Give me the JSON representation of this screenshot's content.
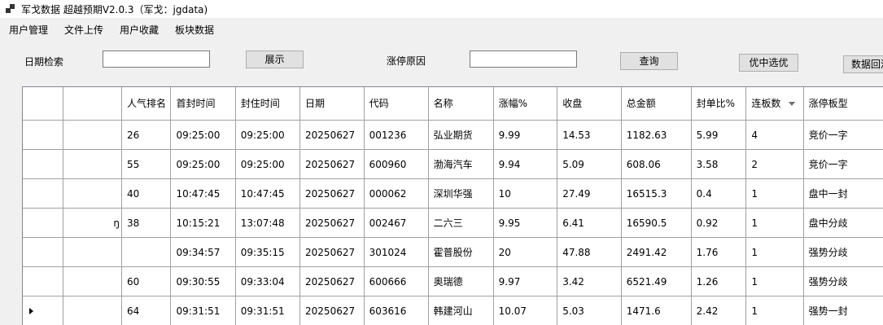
{
  "window": {
    "title": "军戈数据 超越预期V2.0.3（军戈：jgdata)"
  },
  "menu": [
    "用户管理",
    "文件上传",
    "用户收藏",
    "板块数据"
  ],
  "toolbar": {
    "date_label": "日期检索",
    "date_value": "",
    "show_button": "展示",
    "reason_label": "涨停原因",
    "reason_value": "",
    "query_button": "查询",
    "select_button": "优中选优",
    "backtest_button": "数据回测"
  },
  "grid": {
    "columns": [
      "",
      "人气排名",
      "首封时间",
      "封住时间",
      "日期",
      "代码",
      "名称",
      "涨幅%",
      "收盘",
      "总金额",
      "封单比%",
      "连板数",
      "涨停板型"
    ],
    "rows": [
      [
        "",
        "26",
        "09:25:00",
        "09:25:00",
        "20250627",
        "001236",
        "弘业期货",
        "9.99",
        "14.53",
        "1182.63",
        "5.99",
        "4",
        "竞价一字"
      ],
      [
        "",
        "55",
        "09:25:00",
        "09:25:00",
        "20250627",
        "600960",
        "渤海汽车",
        "9.94",
        "5.09",
        "608.06",
        "3.58",
        "2",
        "竞价一字"
      ],
      [
        "",
        "40",
        "10:47:45",
        "10:47:45",
        "20250627",
        "000062",
        "深圳华强",
        "10",
        "27.49",
        "16515.3",
        "0.4",
        "1",
        "盘中一封"
      ],
      [
        "ŋ",
        "38",
        "10:15:21",
        "13:07:48",
        "20250627",
        "002467",
        "二六三",
        "9.95",
        "6.41",
        "16590.5",
        "0.92",
        "1",
        "盘中分歧"
      ],
      [
        "",
        "",
        "09:34:57",
        "09:35:15",
        "20250627",
        "301024",
        "霍普股份",
        "20",
        "47.88",
        "2491.42",
        "1.76",
        "1",
        "强势分歧"
      ],
      [
        "",
        "60",
        "09:30:55",
        "09:33:04",
        "20250627",
        "600666",
        "奥瑞德",
        "9.97",
        "3.42",
        "6521.49",
        "1.26",
        "1",
        "强势分歧"
      ],
      [
        "",
        "64",
        "09:31:51",
        "09:31:51",
        "20250627",
        "603616",
        "韩建河山",
        "10.07",
        "5.03",
        "1471.6",
        "2.42",
        "1",
        "强势一封"
      ]
    ],
    "current_row_index": 6
  }
}
